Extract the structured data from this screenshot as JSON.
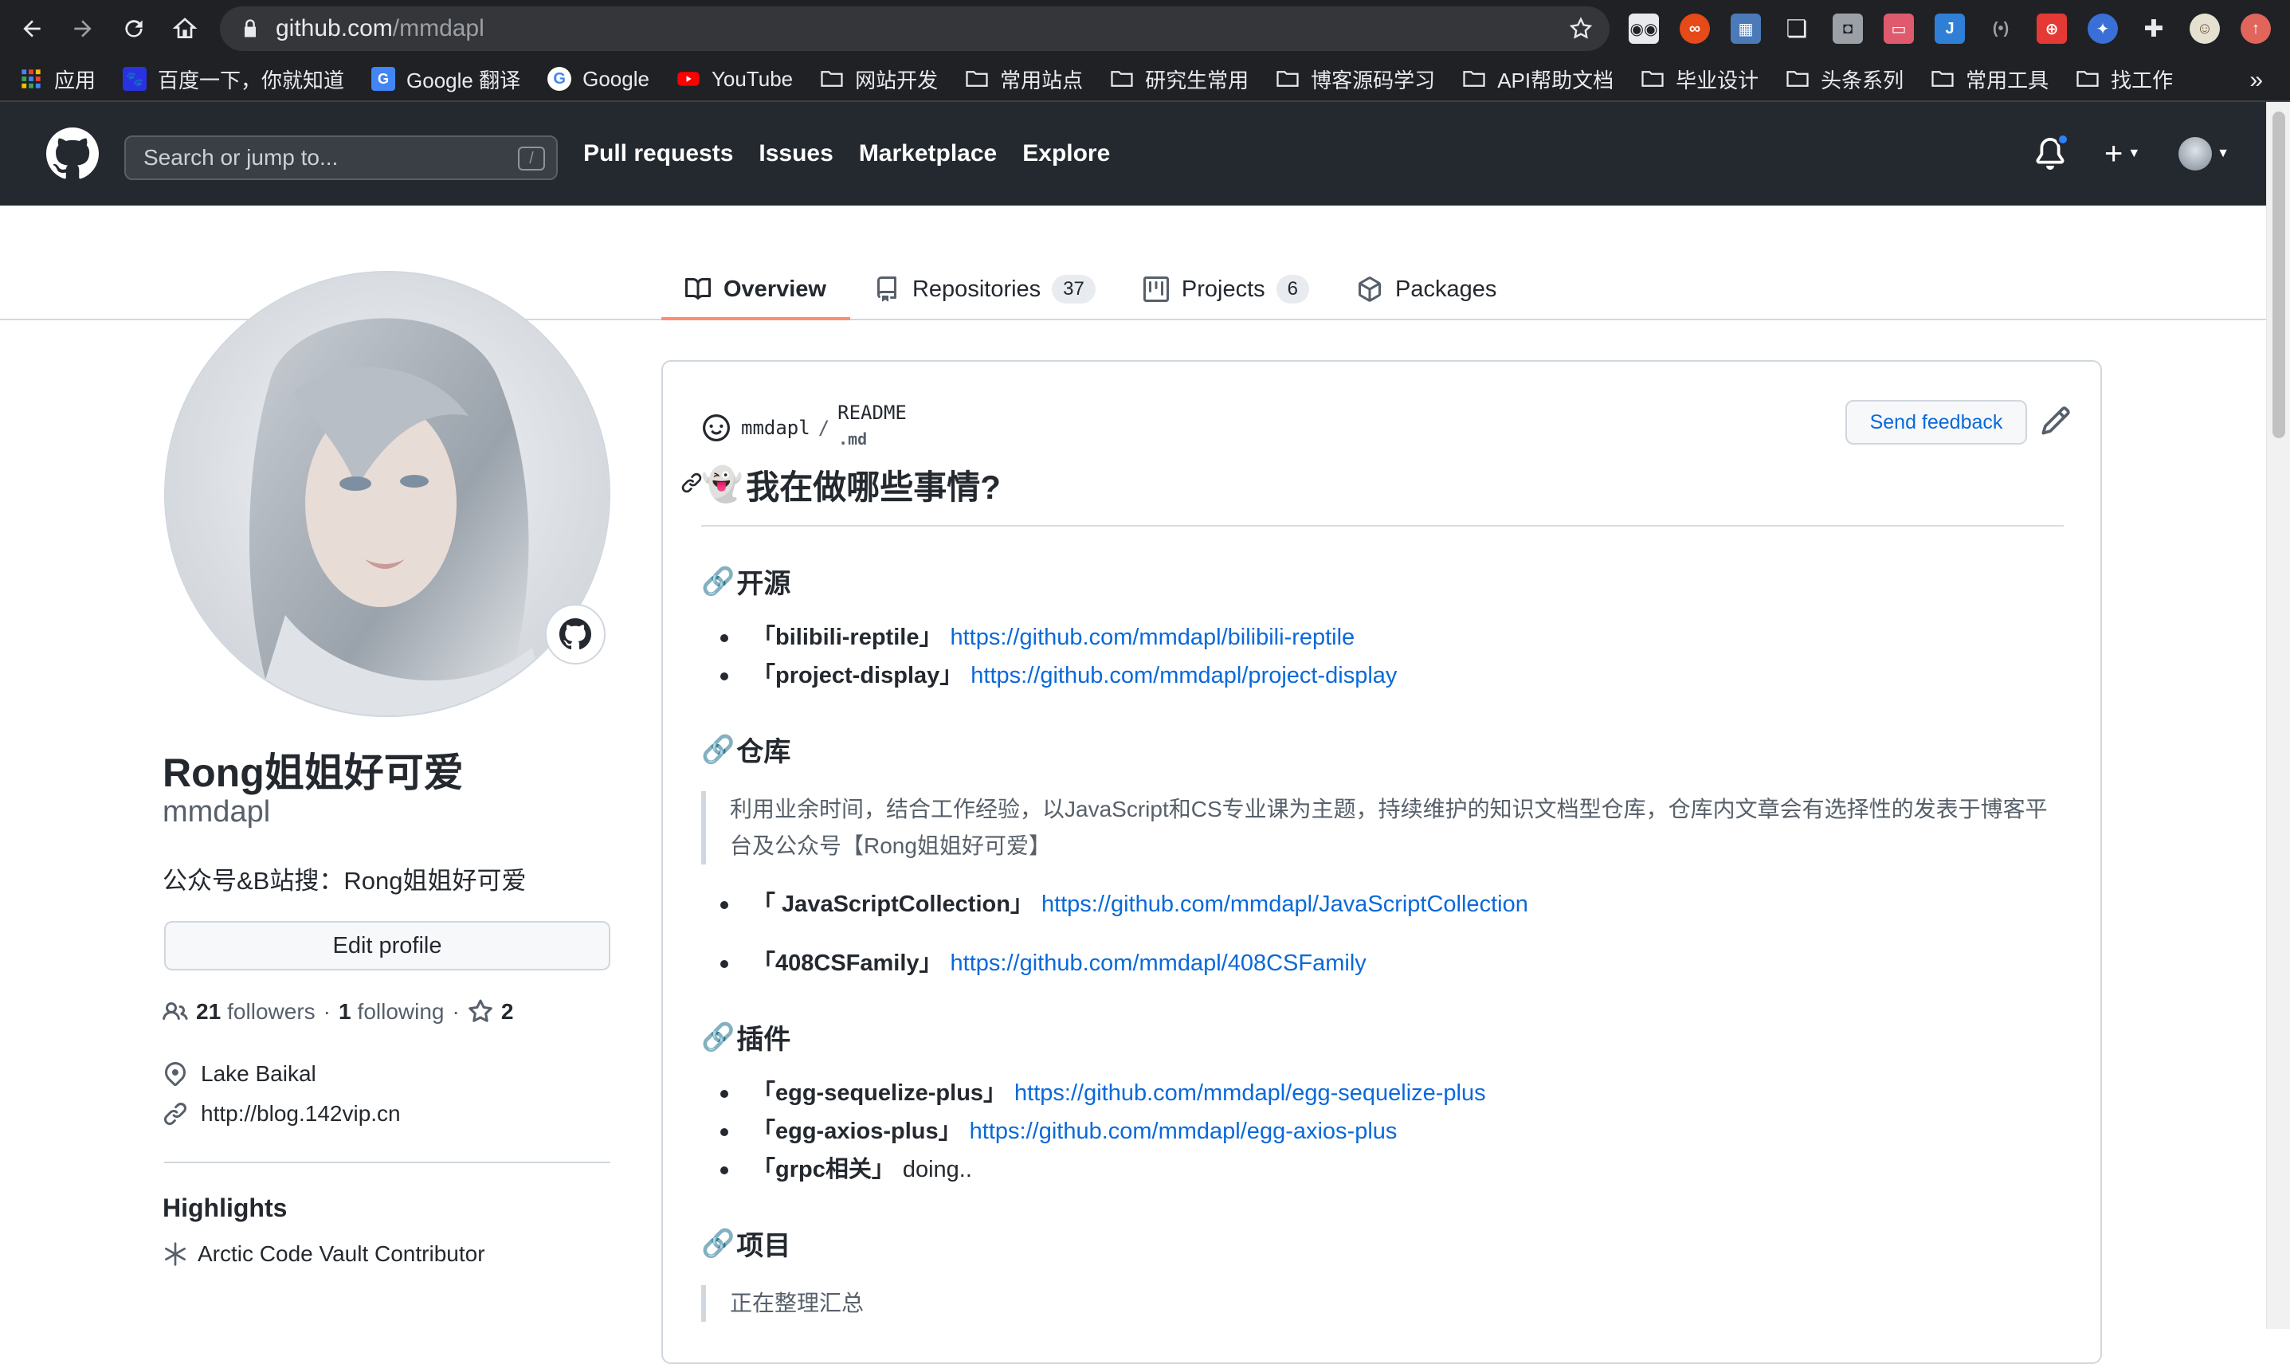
{
  "browser": {
    "url_host": "github.com",
    "url_path": "/mmdapl",
    "bookmarks": [
      {
        "label": "应用",
        "icon": "apps-grid-icon"
      },
      {
        "label": "百度一下，你就知道",
        "icon": "baidu-icon"
      },
      {
        "label": "Google 翻译",
        "icon": "google-translate-icon"
      },
      {
        "label": "Google",
        "icon": "google-icon"
      },
      {
        "label": "YouTube",
        "icon": "youtube-icon"
      },
      {
        "label": "网站开发",
        "icon": "folder-icon"
      },
      {
        "label": "常用站点",
        "icon": "folder-icon"
      },
      {
        "label": "研究生常用",
        "icon": "folder-icon"
      },
      {
        "label": "博客源码学习",
        "icon": "folder-icon"
      },
      {
        "label": "API帮助文档",
        "icon": "folder-icon"
      },
      {
        "label": "毕业设计",
        "icon": "folder-icon"
      },
      {
        "label": "头条系列",
        "icon": "folder-icon"
      },
      {
        "label": "常用工具",
        "icon": "folder-icon"
      },
      {
        "label": "找工作",
        "icon": "folder-icon"
      }
    ],
    "bookmarks_more": "»"
  },
  "github": {
    "search_placeholder": "Search or jump to...",
    "search_hint": "/",
    "nav": [
      "Pull requests",
      "Issues",
      "Marketplace",
      "Explore"
    ]
  },
  "tabs": [
    {
      "label": "Overview",
      "count": null,
      "active": true
    },
    {
      "label": "Repositories",
      "count": "37"
    },
    {
      "label": "Projects",
      "count": "6"
    },
    {
      "label": "Packages",
      "count": null
    }
  ],
  "profile": {
    "full_name": "Rong姐姐好可爱",
    "username": "mmdapl",
    "bio": "公众号&B站搜：Rong姐姐好可爱",
    "edit_button": "Edit profile",
    "followers_count": "21",
    "followers_label": "followers",
    "following_count": "1",
    "following_label": "following",
    "stars_count": "2",
    "location": "Lake Baikal",
    "website": "http://blog.142vip.cn",
    "highlights_title": "Highlights",
    "highlight": "Arctic Code Vault Contributor"
  },
  "readme": {
    "owner": "mmdapl",
    "file_name": "README",
    "file_ext": ".md",
    "send_feedback": "Send feedback",
    "title_emoji": "👻",
    "title": "我在做哪些事情?",
    "sections": [
      {
        "heading": "开源",
        "items": [
          {
            "name": "「bilibili-reptile」",
            "link": "https://github.com/mmdapl/bilibili-reptile"
          },
          {
            "name": "「project-display」",
            "link": "https://github.com/mmdapl/project-display"
          }
        ]
      },
      {
        "heading": "仓库",
        "quote": "利用业余时间，结合工作经验，以JavaScript和CS专业课为主题，持续维护的知识文档型仓库，仓库内文章会有选择性的发表于博客平台及公众号【Rong姐姐好可爱】",
        "items": [
          {
            "name": "「 JavaScriptCollection」",
            "link": "https://github.com/mmdapl/JavaScriptCollection"
          },
          {
            "name": "「408CSFamily」",
            "link": "https://github.com/mmdapl/408CSFamily"
          }
        ]
      },
      {
        "heading": "插件",
        "items": [
          {
            "name": "「egg-sequelize-plus」",
            "link": "https://github.com/mmdapl/egg-sequelize-plus"
          },
          {
            "name": "「egg-axios-plus」",
            "link": "https://github.com/mmdapl/egg-axios-plus"
          },
          {
            "name": "「grpc相关」",
            "text": "doing.."
          }
        ]
      },
      {
        "heading": "项目",
        "quote": "正在整理汇总"
      }
    ],
    "chain_emoji": "🔗"
  },
  "colors": {
    "chrome_bg": "#202124",
    "github_header": "#24292f",
    "link": "#0969da",
    "tab_underline": "#fd8c73",
    "notification_dot": "#2f81f7"
  }
}
